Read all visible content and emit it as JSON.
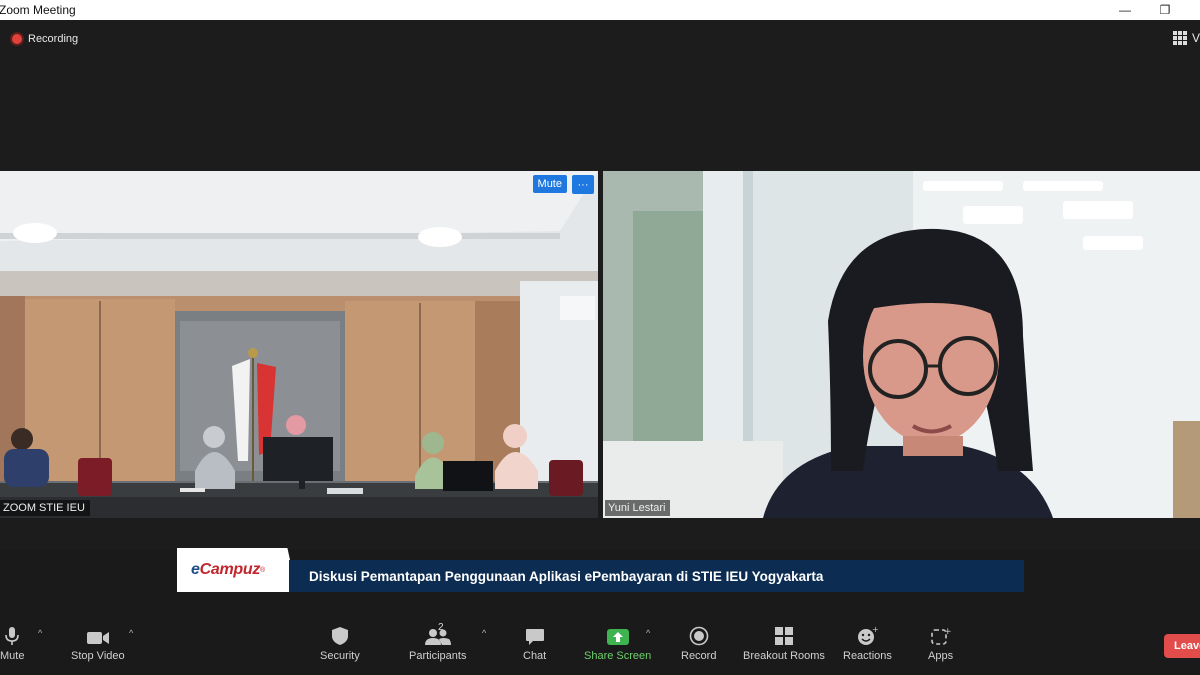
{
  "window": {
    "title": "Zoom Meeting",
    "minimize_label": "—",
    "restore_label": "❐"
  },
  "status": {
    "recording_label": "Recording",
    "view_label": "V"
  },
  "tiles": [
    {
      "name": "ZOOM STIE IEU",
      "mute_label": "Mute",
      "more_label": "···"
    },
    {
      "name": "Yuni Lestari"
    }
  ],
  "banner": {
    "brand_e": "e",
    "brand_rest": "Campuz",
    "brand_mark": "®",
    "caption": "Diskusi Pemantapan Penggunaan Aplikasi ePembayaran di STIE IEU Yogyakarta"
  },
  "toolbar": {
    "mute": "Mute",
    "stop_video": "Stop Video",
    "security": "Security",
    "participants": "Participants",
    "participants_count": "2",
    "chat": "Chat",
    "share_screen": "Share Screen",
    "record": "Record",
    "breakout_rooms": "Breakout Rooms",
    "reactions": "Reactions",
    "apps": "Apps",
    "leave": "Leave",
    "caret": "^"
  },
  "colors": {
    "share_green": "#6cd06c",
    "leave_red": "#e24c4b",
    "mute_blue": "#1f78e0",
    "banner_navy": "#0c2c52",
    "brand_red": "#c0262c"
  }
}
